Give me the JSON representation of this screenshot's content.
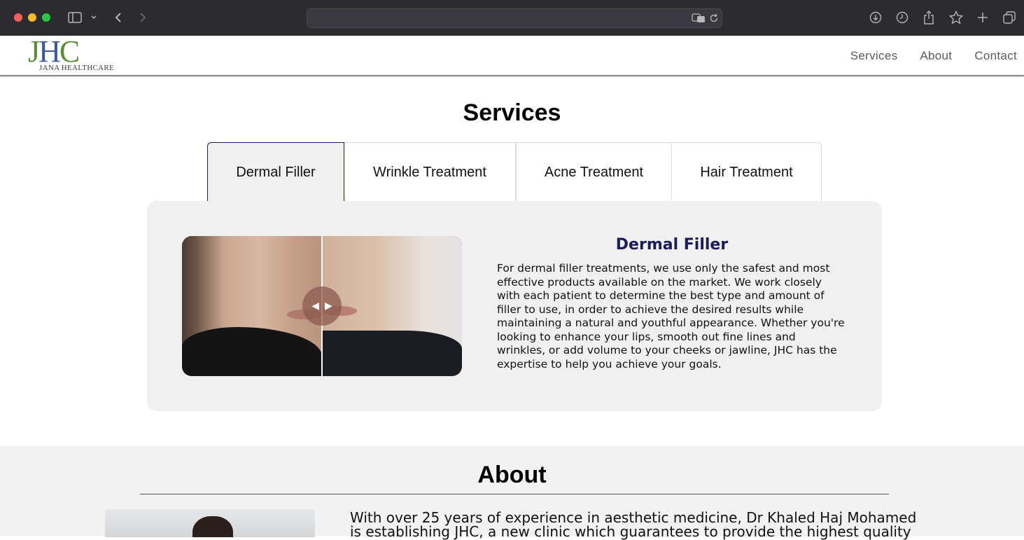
{
  "browser": {
    "icons": [
      "sidebar-icon",
      "chevron-down-icon",
      "back-icon",
      "forward-icon",
      "translate-icon",
      "reload-icon",
      "download-icon",
      "history-icon",
      "share-icon",
      "star-icon",
      "new-tab-icon",
      "tabs-icon"
    ]
  },
  "header": {
    "logo_mark_j": "J",
    "logo_mark_h": "H",
    "logo_mark_c": "C",
    "logo_sub": "JANA HEALTHCARE",
    "nav": [
      "Services",
      "About",
      "Contact"
    ]
  },
  "services": {
    "title": "Services",
    "tabs": [
      "Dermal Filler",
      "Wrinkle Treatment",
      "Acne Treatment",
      "Hair Treatment"
    ],
    "active_tab": "Dermal Filler",
    "panel_title": "Dermal Filler",
    "panel_body": "For dermal filler treatments, we use only the safest and most effective products available on the market. We work closely with each patient to determine the best type and amount of filler to use, in order to achieve the desired results while maintaining a natural and youthful appearance. Whether you're looking to enhance your lips, smooth out fine lines and wrinkles, or add volume to your cheeks or jawline, JHC has the expertise to help you achieve your goals.",
    "slider_position": 0.5
  },
  "about": {
    "title": "About",
    "text": "With over 25 years of experience in aesthetic medicine, Dr Khaled Haj Mohamed is establishing JHC, a new clinic which guarantees to provide the highest quality"
  }
}
